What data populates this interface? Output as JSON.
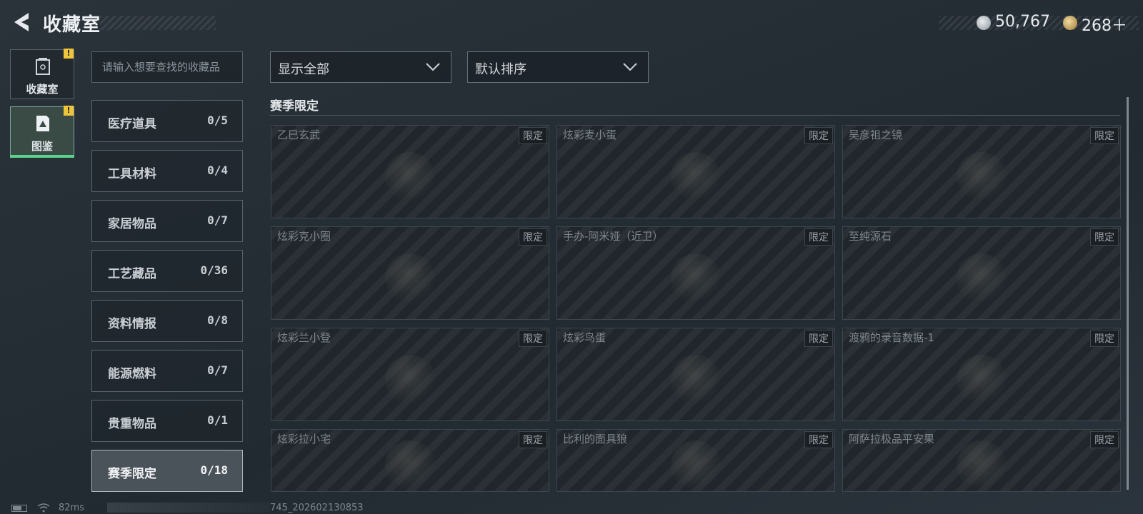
{
  "header": {
    "title": "收藏室"
  },
  "currency": [
    {
      "icon": "silver-coin-icon",
      "value": "50,767"
    },
    {
      "icon": "gold-coin-icon",
      "value": "268＋"
    }
  ],
  "nav": [
    {
      "label": "收藏室",
      "icon": "collection-box-icon",
      "badge": "!"
    },
    {
      "label": "图鉴",
      "icon": "codex-book-icon",
      "badge": "!",
      "selected": true
    }
  ],
  "search": {
    "placeholder": "请输入想要查找的收藏品"
  },
  "categories": [
    {
      "name": "医疗道具",
      "count": "0/5"
    },
    {
      "name": "工具材料",
      "count": "0/4"
    },
    {
      "name": "家居物品",
      "count": "0/7"
    },
    {
      "name": "工艺藏品",
      "count": "0/36"
    },
    {
      "name": "资料情报",
      "count": "0/8"
    },
    {
      "name": "能源燃料",
      "count": "0/7"
    },
    {
      "name": "贵重物品",
      "count": "0/1"
    },
    {
      "name": "赛季限定",
      "count": "0/18",
      "selected": true
    }
  ],
  "filters": {
    "display": "显示全部",
    "sort": "默认排序"
  },
  "section": {
    "title": "赛季限定"
  },
  "items": [
    {
      "name": "乙巳玄武",
      "tag": "限定"
    },
    {
      "name": "炫彩麦小蛋",
      "tag": "限定"
    },
    {
      "name": "吴彦祖之镜",
      "tag": "限定"
    },
    {
      "name": "炫彩克小圈",
      "tag": "限定"
    },
    {
      "name": "手办-阿米娅（近卫）",
      "tag": "限定"
    },
    {
      "name": "至纯源石",
      "tag": "限定"
    },
    {
      "name": "炫彩兰小登",
      "tag": "限定"
    },
    {
      "name": "炫彩鸟蛋",
      "tag": "限定"
    },
    {
      "name": "渡鸦的录音数据-1",
      "tag": "限定"
    },
    {
      "name": "炫彩拉小宅",
      "tag": "限定"
    },
    {
      "name": "比利的面具狼",
      "tag": "限定"
    },
    {
      "name": "阿萨拉极品平安果",
      "tag": "限定"
    }
  ],
  "footer": {
    "ping": "82ms",
    "uid": "745_202602130853"
  },
  "colors": {
    "accent_green": "#5bd28e",
    "badge_yellow": "#f0c43a"
  }
}
